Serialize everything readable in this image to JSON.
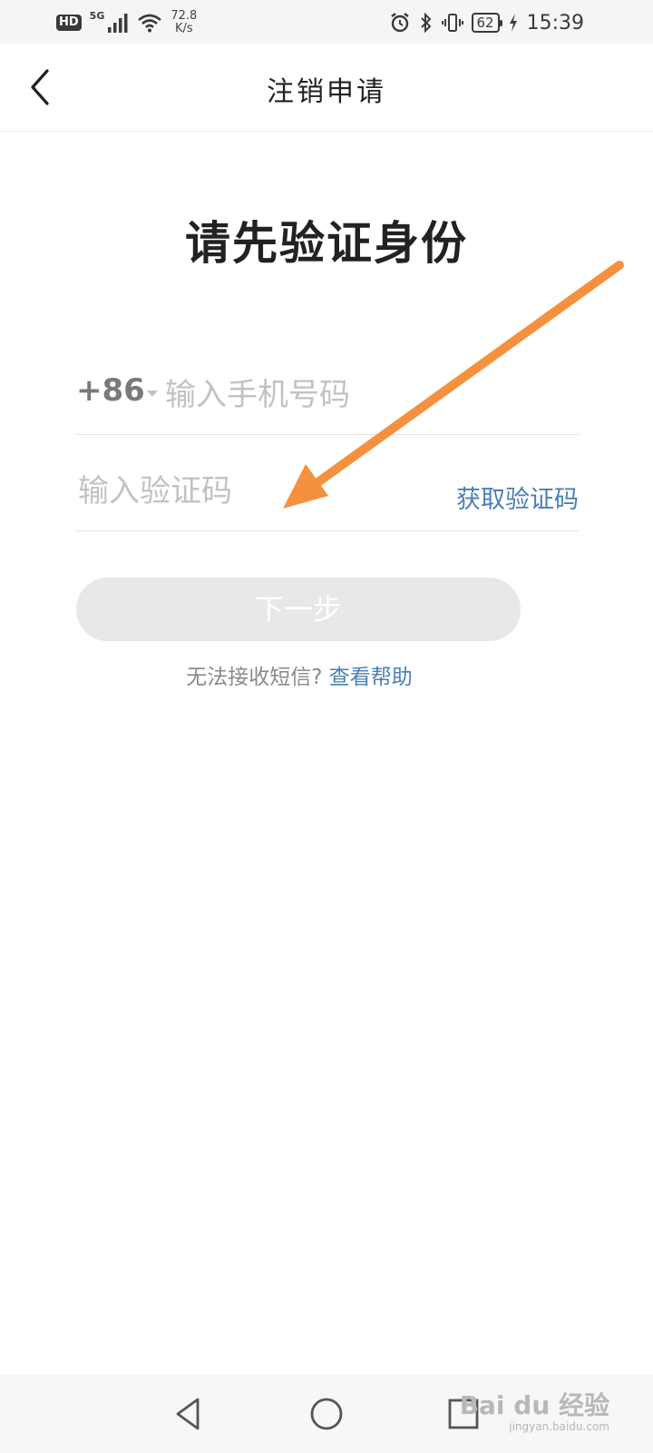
{
  "status_bar": {
    "hd": "HD",
    "network": "5G",
    "speed_value": "72.8",
    "speed_unit": "K/s",
    "battery": "62",
    "time": "15:39"
  },
  "header": {
    "title": "注销申请",
    "back_icon": "chevron-left-icon"
  },
  "main": {
    "heading": "请先验证身份",
    "phone": {
      "country_code": "+86",
      "placeholder": "输入手机号码",
      "value": ""
    },
    "code": {
      "placeholder": "输入验证码",
      "value": "",
      "get_code_label": "获取验证码"
    },
    "next_button": "下一步",
    "help_question": "无法接收短信?",
    "help_link": "查看帮助"
  },
  "annotation": {
    "arrow_color": "#f5913e"
  },
  "nav": {
    "back_icon": "triangle-back-icon",
    "home_icon": "circle-home-icon",
    "recent_icon": "square-recent-icon"
  },
  "watermark": {
    "brand": "Bai du 经验",
    "url": "jingyan.baidu.com"
  },
  "colors": {
    "link": "#4a7fb5",
    "button_disabled": "#e8e8e8"
  }
}
